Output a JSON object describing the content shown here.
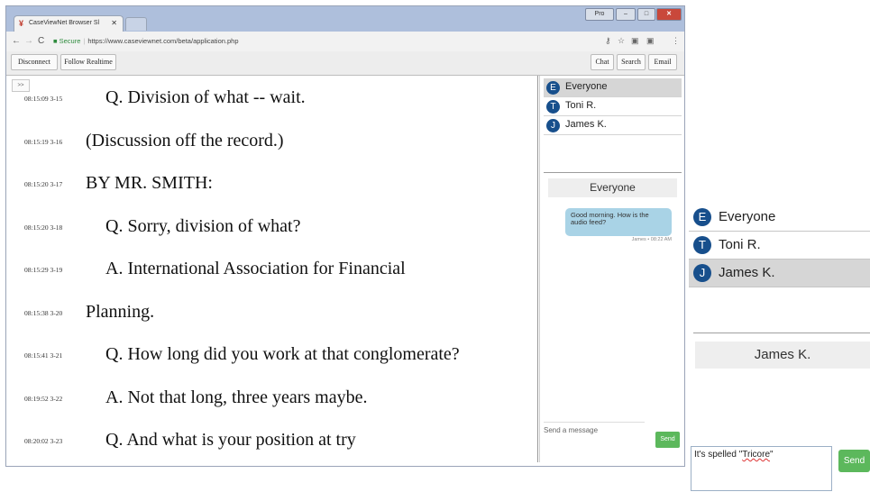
{
  "browser": {
    "tab_title": "CaseViewNet Browser Sl",
    "tab_close": "✕",
    "favicon": "¥",
    "url_secure_label": "Secure",
    "url": "https://www.caseviewnet.com/beta/application.php",
    "win_profile": "Pro",
    "win_min": "–",
    "win_max": "□",
    "win_close": "✕",
    "icons": [
      "back-arrow",
      "forward-arrow",
      "reload",
      "lock",
      "key",
      "star",
      "extension",
      "menu"
    ]
  },
  "toolbar": {
    "disconnect_label": "Disconnect",
    "follow_label": "Follow Realtime",
    "chat_label": "Chat",
    "search_label": "Search",
    "email_label": "Email"
  },
  "transcript": {
    "expand_label": ">>",
    "lines": [
      {
        "stamp": "08:15:09  3-15",
        "text": "Q.  Division of what -- wait."
      },
      {
        "stamp": "08:15:19  3-16",
        "text": "(Discussion off the record.)"
      },
      {
        "stamp": "08:15:20  3-17",
        "text": "BY MR. SMITH:"
      },
      {
        "stamp": "08:15:20  3-18",
        "text": "Q.  Sorry, division of what?"
      },
      {
        "stamp": "08:15:29  3-19",
        "text": "A.  International Association for Financial"
      },
      {
        "stamp": "08:15:38  3-20",
        "text": "Planning."
      },
      {
        "stamp": "08:15:41  3-21",
        "text": "Q.  How long did you work at that conglomerate?"
      },
      {
        "stamp": "08:19:52  3-22",
        "text": "A.  Not that long, three years maybe."
      },
      {
        "stamp": "08:20:02  3-23",
        "text": "Q.  And what is your position at try"
      }
    ]
  },
  "chat": {
    "users": [
      {
        "initial": "E",
        "name": "Everyone",
        "selected": true
      },
      {
        "initial": "T",
        "name": "Toni R.",
        "selected": false
      },
      {
        "initial": "J",
        "name": "James K.",
        "selected": false
      }
    ],
    "active_conversation": "Everyone",
    "message": {
      "text": "Good morning. How is the audio feed?",
      "meta": "James • 08:22 AM"
    },
    "input_placeholder": "Send a message",
    "send_label": "Send"
  },
  "zoom_inset": {
    "users": [
      {
        "initial": "E",
        "name": "Everyone",
        "selected": false
      },
      {
        "initial": "T",
        "name": "Toni R.",
        "selected": false
      },
      {
        "initial": "J",
        "name": "James K.",
        "selected": true
      }
    ],
    "active_conversation": "James K.",
    "input_value_prefix": "It's spelled \"",
    "input_value_word": "Tricore",
    "input_value_suffix": "\"",
    "send_label": "Send"
  },
  "colors": {
    "titlebar": "#aebfdc",
    "avatar": "#174f8c",
    "bubble": "#a9d3e6",
    "send": "#5cb85c",
    "close": "#c9483b"
  }
}
